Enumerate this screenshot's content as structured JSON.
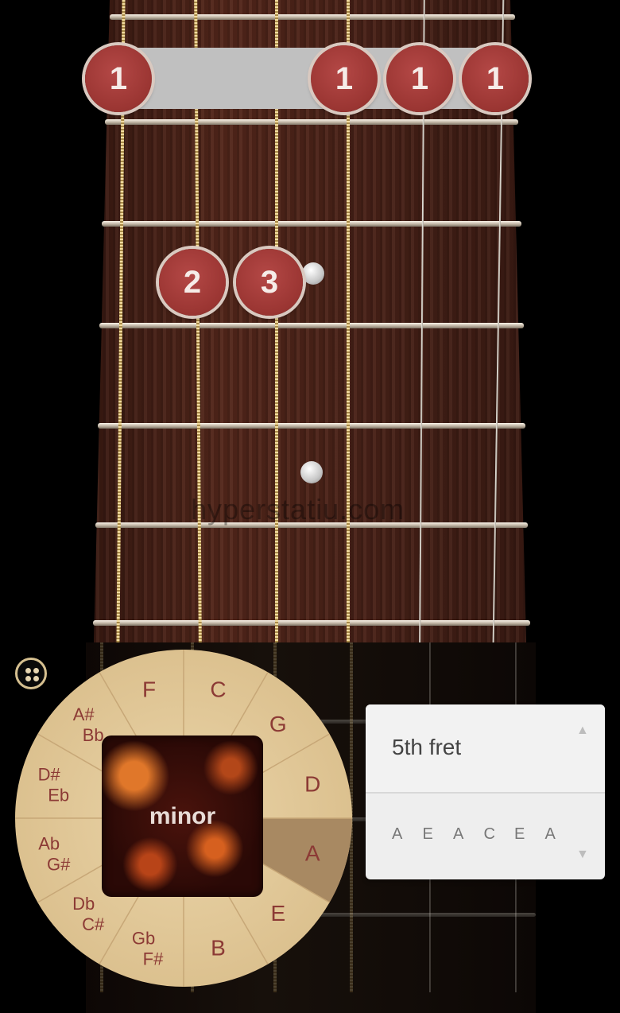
{
  "fretboard": {
    "fingers": [
      {
        "label": "1"
      },
      {
        "label": "1"
      },
      {
        "label": "1"
      },
      {
        "label": "1"
      },
      {
        "label": "2"
      },
      {
        "label": "3"
      }
    ],
    "watermark": "hyperstatiu.com"
  },
  "menu": {
    "icon": "grid-dots-icon"
  },
  "circle_of_fifths": {
    "center_mode": "minor",
    "selected_key": "A",
    "keys": [
      {
        "top": "F",
        "bottom": ""
      },
      {
        "top": "C",
        "bottom": ""
      },
      {
        "top": "G",
        "bottom": ""
      },
      {
        "top": "D",
        "bottom": ""
      },
      {
        "top": "A",
        "bottom": ""
      },
      {
        "top": "E",
        "bottom": ""
      },
      {
        "top": "B",
        "bottom": ""
      },
      {
        "top": "Gb",
        "bottom": "F#"
      },
      {
        "top": "Db",
        "bottom": "C#"
      },
      {
        "top": "Ab",
        "bottom": "G#"
      },
      {
        "top": "D#",
        "bottom": "Eb"
      },
      {
        "top": "A#",
        "bottom": "Bb"
      }
    ],
    "colors": {
      "wood": "#e3c99a",
      "selected": "#a88962",
      "text": "#8c3a35"
    }
  },
  "fret_selector": {
    "position_label": "5th fret",
    "tuning": [
      "A",
      "E",
      "A",
      "C",
      "E",
      "A"
    ],
    "up_arrow": "▲",
    "down_arrow": "▼"
  }
}
